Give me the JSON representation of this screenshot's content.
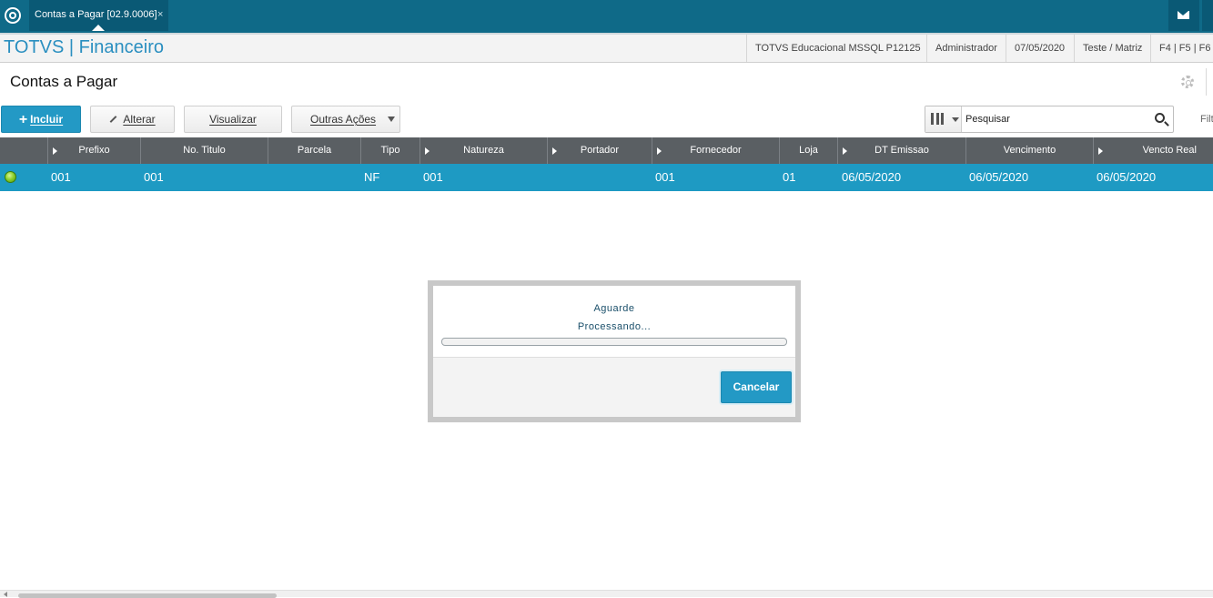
{
  "topbar": {
    "tab_label": "Contas a Pagar [02.9.0006]",
    "tab_close": "×"
  },
  "header": {
    "brand": "TOTVS | Financeiro",
    "environment": "TOTVS Educacional MSSQL P12125",
    "user": "Administrador",
    "date": "07/05/2020",
    "branch": "Teste / Matriz",
    "shortcuts": "F4 | F5 | F6 |"
  },
  "page": {
    "title": "Contas a Pagar"
  },
  "toolbar": {
    "include_label": "Incluir",
    "include_plus": "+",
    "alter_label": "Alterar",
    "view_label": "Visualizar",
    "other_label": "Outras Ações",
    "search_placeholder": "Pesquisar",
    "filter_label": "Filt"
  },
  "grid": {
    "columns": [
      {
        "label": ""
      },
      {
        "label": "Prefixo"
      },
      {
        "label": "No. Titulo"
      },
      {
        "label": "Parcela"
      },
      {
        "label": "Tipo"
      },
      {
        "label": "Natureza"
      },
      {
        "label": "Portador"
      },
      {
        "label": "Fornecedor"
      },
      {
        "label": "Loja"
      },
      {
        "label": "DT Emissao"
      },
      {
        "label": "Vencimento"
      },
      {
        "label": "Vencto Real"
      }
    ],
    "rows": [
      {
        "status": "green",
        "prefixo": "001",
        "no_titulo": "001",
        "parcela": "",
        "tipo": "NF",
        "natureza": "001",
        "portador": "",
        "fornecedor": "001",
        "loja": "01",
        "dt_emissao": "06/05/2020",
        "vencimento": "06/05/2020",
        "vencto_real": "06/05/2020"
      }
    ]
  },
  "modal": {
    "line1": "Aguarde",
    "line2": "Processando...",
    "progress": 0,
    "cancel_label": "Cancelar"
  },
  "colors": {
    "topbar": "#0f6a88",
    "accent": "#2399c5",
    "grid_header": "#5a5f63",
    "selected_row": "#1e9ac3",
    "status_green": "#8fd12f"
  }
}
